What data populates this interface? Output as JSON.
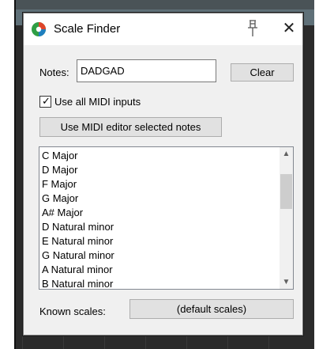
{
  "window": {
    "title": "Scale Finder",
    "pin_icon": "pin-icon",
    "close_icon": "close-icon",
    "close_glyph": "✕"
  },
  "notes": {
    "label": "Notes:",
    "value": "DADGAD"
  },
  "buttons": {
    "clear_label": "Clear",
    "midi_editor_label": "Use MIDI editor selected notes",
    "known_scales_label": "(default scales)"
  },
  "midi_inputs": {
    "label": "Use all MIDI inputs",
    "checked": true
  },
  "scales": [
    "C Major",
    "D Major",
    "F Major",
    "G Major",
    "A# Major",
    "D Natural minor",
    "E Natural minor",
    "G Natural minor",
    "A Natural minor",
    "B Natural minor"
  ],
  "known_scales": {
    "label": "Known scales:"
  },
  "colors": {
    "dialog_bg": "#f0f0f0",
    "button_bg": "#e1e1e1",
    "app_icon_colors": [
      "#e0452a",
      "#1f7fbf",
      "#2f9e44"
    ]
  }
}
